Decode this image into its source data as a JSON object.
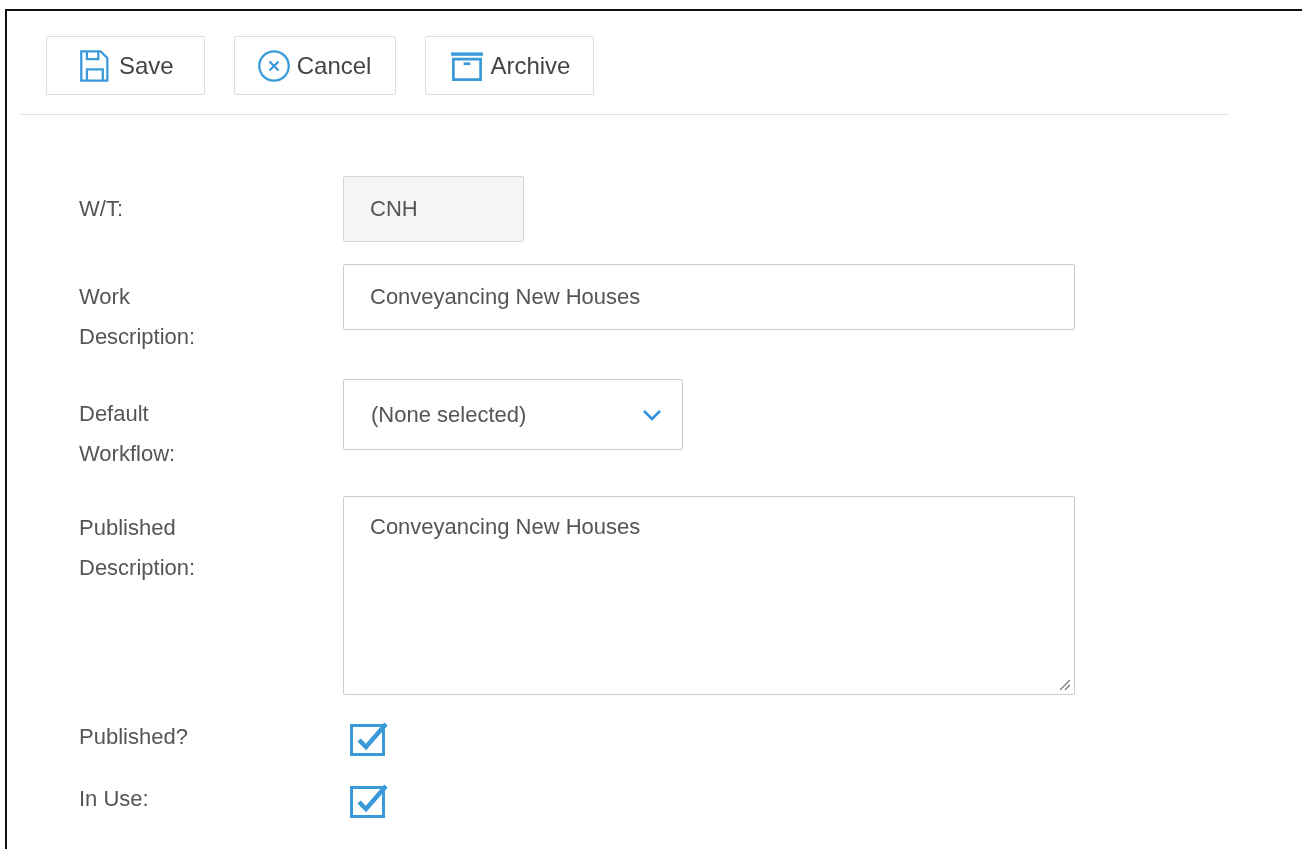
{
  "toolbar": [
    {
      "kind": "save",
      "label": "Save"
    },
    {
      "kind": "cancel",
      "label": "Cancel"
    },
    {
      "kind": "archive",
      "label": "Archive"
    }
  ],
  "fields": [
    {
      "kind": "readonly",
      "label": "W/T:",
      "value": "CNH"
    },
    {
      "kind": "text",
      "label": "Work Description:",
      "value": "Conveyancing New Houses"
    },
    {
      "kind": "select",
      "label": "Default Workflow:",
      "value": "(None selected)"
    },
    {
      "kind": "textarea",
      "label": "Published Description:",
      "value": "Conveyancing New Houses"
    },
    {
      "kind": "checkbox",
      "label": "Published?",
      "checked": true
    },
    {
      "kind": "checkbox",
      "label": "In Use:",
      "checked": true
    }
  ]
}
